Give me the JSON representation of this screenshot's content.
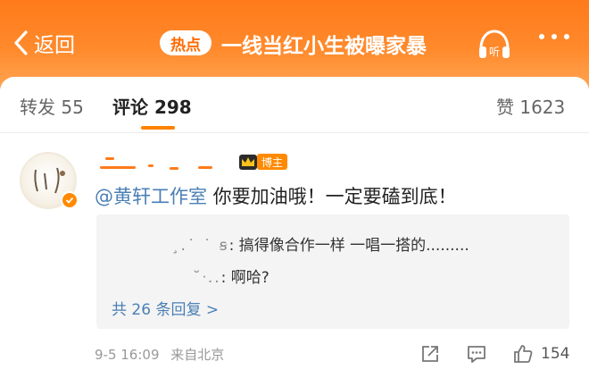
{
  "header": {
    "back_label": "返回",
    "hot_badge": "热点",
    "title": "一线当红小生被曝家暴",
    "listen_label": "听"
  },
  "tabs": [
    {
      "label": "转发 55"
    },
    {
      "label": "评论 298"
    },
    {
      "label": "赞 1623"
    }
  ],
  "comment": {
    "username": "",
    "role_badge": "博主",
    "mention": "@黄轩工作室",
    "text": " 你要加油哦！一定要磕到底！",
    "replies": [
      {
        "name": "¸.˙ ˙ ꞩ",
        "text": ": 搞得像合作一样 一唱一搭的........."
      },
      {
        "name": "˘ᐧ..",
        "text": ": 啊哈?"
      }
    ],
    "more_replies": "共 26 条回复 >",
    "time": "9-5 16:09",
    "source": "来自北京",
    "like_count": "154"
  },
  "colors": {
    "accent": "#ff8200",
    "header": "#ff7a1a",
    "link": "#4a7fb5"
  }
}
